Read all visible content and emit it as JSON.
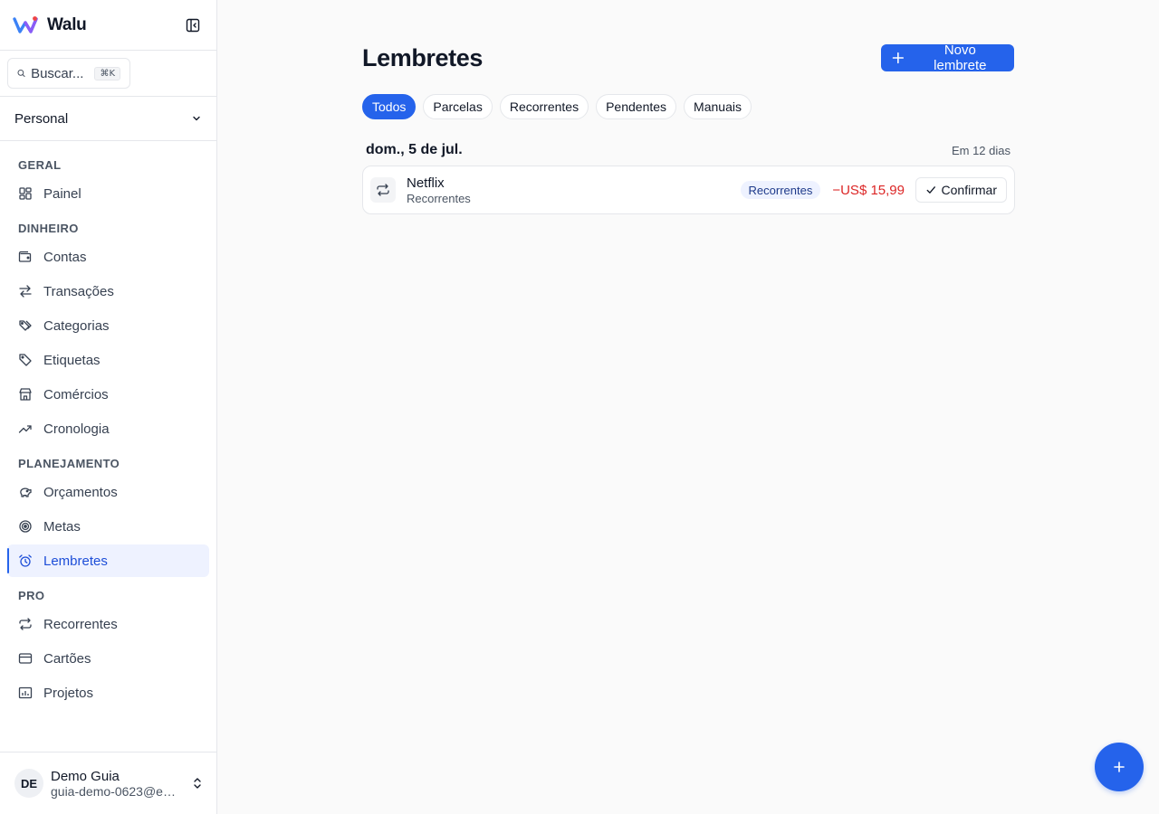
{
  "app": {
    "name": "Walu"
  },
  "colors": {
    "accent": "#2563eb",
    "negative": "#dc2626",
    "active_bg": "#eef2ff"
  },
  "search": {
    "placeholder": "Buscar...",
    "shortcut": "⌘K"
  },
  "workspace": {
    "name": "Personal"
  },
  "sidebar": {
    "sections": [
      {
        "title": "GERAL",
        "items": [
          {
            "label": "Painel",
            "icon": "dashboard-icon"
          }
        ]
      },
      {
        "title": "DINHEIRO",
        "items": [
          {
            "label": "Contas",
            "icon": "wallet-icon"
          },
          {
            "label": "Transações",
            "icon": "arrows-exchange-icon"
          },
          {
            "label": "Categorias",
            "icon": "tags-icon"
          },
          {
            "label": "Etiquetas",
            "icon": "tag-icon"
          },
          {
            "label": "Comércios",
            "icon": "store-icon"
          },
          {
            "label": "Cronologia",
            "icon": "trending-up-icon"
          }
        ]
      },
      {
        "title": "PLANEJAMENTO",
        "items": [
          {
            "label": "Orçamentos",
            "icon": "piggy-bank-icon"
          },
          {
            "label": "Metas",
            "icon": "target-icon"
          },
          {
            "label": "Lembretes",
            "icon": "alarm-clock-icon",
            "active": true
          }
        ]
      },
      {
        "title": "PRO",
        "items": [
          {
            "label": "Recorrentes",
            "icon": "repeat-icon"
          },
          {
            "label": "Cartões",
            "icon": "credit-card-icon"
          },
          {
            "label": "Projetos",
            "icon": "folder-chart-icon"
          }
        ]
      }
    ]
  },
  "user": {
    "initials": "DE",
    "name": "Demo Guia",
    "email": "guia-demo-0623@ex..."
  },
  "page": {
    "title": "Lembretes",
    "new_button": "Novo lembrete",
    "filters": [
      {
        "label": "Todos",
        "active": true
      },
      {
        "label": "Parcelas"
      },
      {
        "label": "Recorrentes"
      },
      {
        "label": "Pendentes"
      },
      {
        "label": "Manuais"
      }
    ],
    "groups": [
      {
        "date": "dom., 5 de jul.",
        "relative": "Em 12 dias",
        "items": [
          {
            "title": "Netflix",
            "subtitle": "Recorrentes",
            "badge": "Recorrentes",
            "amount": "−US$ 15,99",
            "action": "Confirmar",
            "icon": "repeat-icon"
          }
        ]
      }
    ]
  }
}
